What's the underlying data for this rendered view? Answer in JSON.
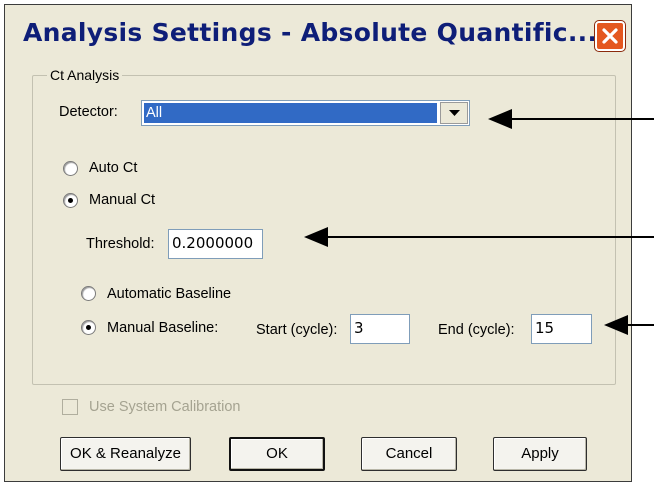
{
  "window": {
    "title": "Analysis Settings - Absolute Quantific..."
  },
  "ct_analysis": {
    "legend": "Ct Analysis",
    "detector_label": "Detector:",
    "detector_value": "All",
    "auto_ct_label": "Auto Ct",
    "manual_ct_label": "Manual Ct",
    "manual_ct_selected": true,
    "threshold_label": "Threshold:",
    "threshold_value": "0.2000000",
    "automatic_baseline_label": "Automatic Baseline",
    "manual_baseline_label": "Manual Baseline:",
    "manual_baseline_selected": true,
    "start_label": "Start (cycle):",
    "start_value": "3",
    "end_label": "End (cycle):",
    "end_value": "15"
  },
  "calibration": {
    "label": "Use System Calibration",
    "enabled": false,
    "checked": false
  },
  "buttons": {
    "ok_reanalyze": "OK & Reanalyze",
    "ok": "OK",
    "cancel": "Cancel",
    "apply": "Apply"
  },
  "icons": [
    "close-icon",
    "dropdown-arrow-icon",
    "callout-arrow-icon"
  ],
  "colors": {
    "title": "#0e1e78",
    "close_button": "#e4571f",
    "selection": "#316ac5",
    "dialog_bg": "#ece9d8"
  }
}
